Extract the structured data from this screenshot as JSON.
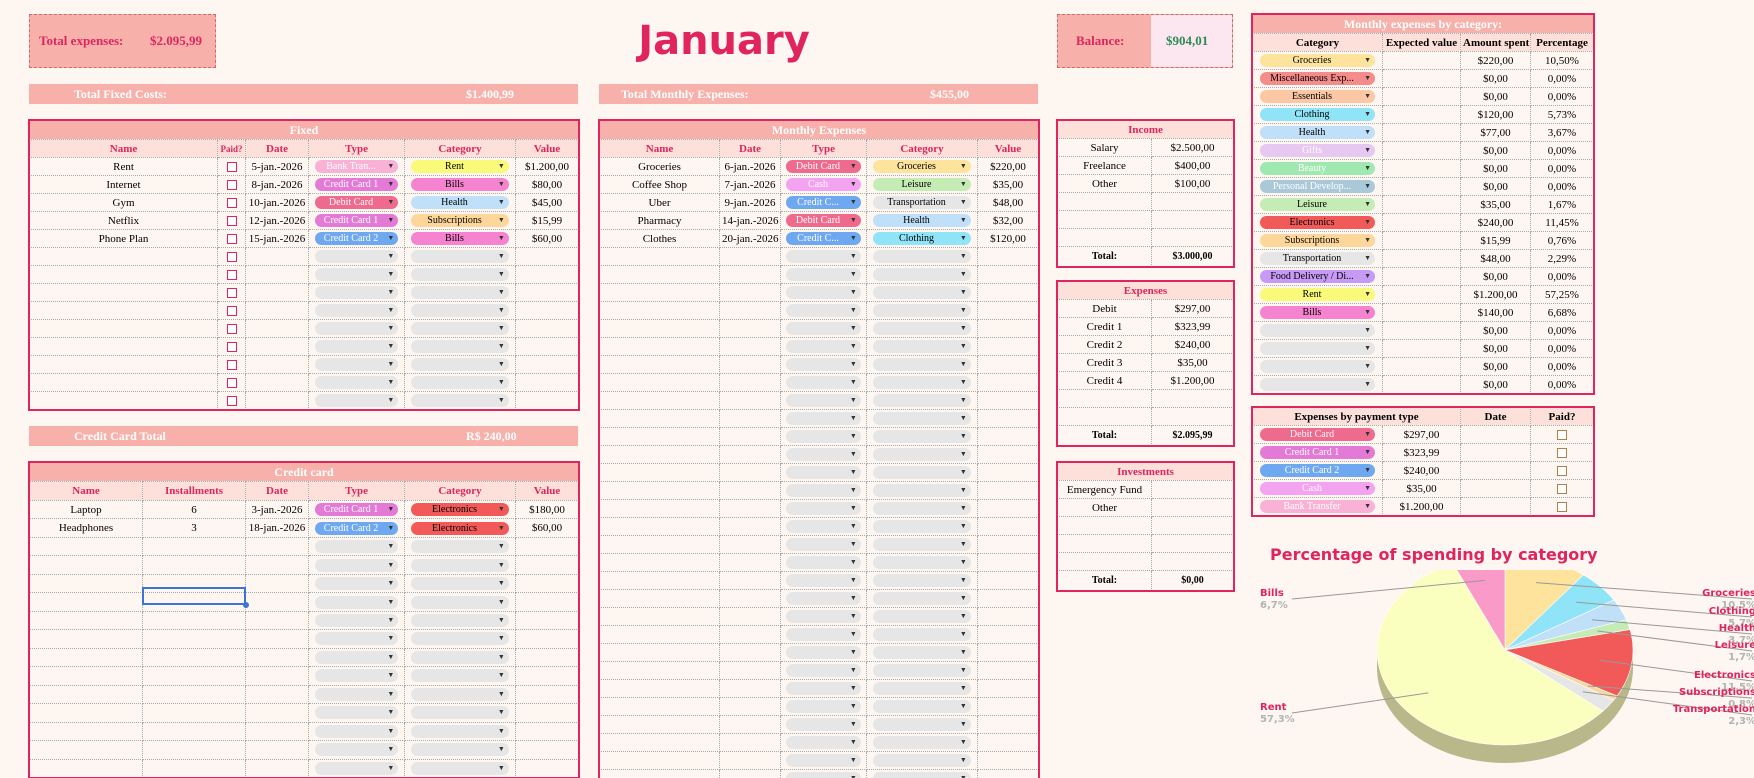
{
  "month": "January",
  "summary": {
    "total_label": "Total expenses:",
    "total_value": "$2.095,99",
    "balance_label": "Balance:",
    "balance_value": "$904,01"
  },
  "bars": {
    "fixed_label": "Total Fixed Costs:",
    "fixed_value": "$1.400,99",
    "monthly_label": "Total Monthly Expenses:",
    "monthly_value": "$455,00",
    "cc_label": "Credit Card Total",
    "cc_value": "R$ 240,00"
  },
  "colors": {
    "accent": "#e0245e",
    "header_bg": "#f7b1aa",
    "subheader_bg": "#fde0da",
    "page_bg": "#fdf6f1",
    "balance_green": "#2e8b57"
  },
  "chip_colors": {
    "Bank Tran...": "#f9b2d6",
    "Bank Transfer": "#f9b2d6",
    "Credit Card 1": "#e27ad6",
    "Credit Card 2": "#6ea8f0",
    "Credit C...": "#6ea8f0",
    "Debit Card": "#ee6b8d",
    "Cash": "#f3a3f0",
    "Rent": "#fafa7a",
    "Bills": "#f683cf",
    "Health": "#bfe0f8",
    "Subscriptions": "#fdd79a",
    "Groceries": "#fde39c",
    "Leisure": "#c6ecb5",
    "Transportation": "#e6e6e6",
    "Clothing": "#8fe4f8",
    "Electronics": "#f25a5a",
    "Miscellaneous Exp...": "#f58c8c",
    "Essentials": "#fbc7a4",
    "Gifts": "#e7c8f1",
    "Beauty": "#9fe8b0",
    "Personal Develop...": "#a9c9d9",
    "Food Delivery / Di...": "#c69af5",
    "": "#e6e6e6"
  },
  "fixed": {
    "title": "Fixed",
    "headers": [
      "Name",
      "Paid?",
      "Date",
      "Type",
      "Category",
      "Value"
    ],
    "rows": [
      {
        "name": "Rent",
        "date": "5-jan.-2026",
        "type": "Bank Tran...",
        "category": "Rent",
        "value": "$1.200,00"
      },
      {
        "name": "Internet",
        "date": "8-jan.-2026",
        "type": "Credit Card 1",
        "category": "Bills",
        "value": "$80,00"
      },
      {
        "name": "Gym",
        "date": "10-jan.-2026",
        "type": "Debit Card",
        "category": "Health",
        "value": "$45,00"
      },
      {
        "name": "Netflix",
        "date": "12-jan.-2026",
        "type": "Credit Card 1",
        "category": "Subscriptions",
        "value": "$15,99"
      },
      {
        "name": "Phone Plan",
        "date": "15-jan.-2026",
        "type": "Credit Card 2",
        "category": "Bills",
        "value": "$60,00"
      }
    ],
    "empty_rows": 9
  },
  "credit_card": {
    "title": "Credit card",
    "headers": [
      "Name",
      "Installments",
      "Date",
      "Type",
      "Category",
      "Value"
    ],
    "rows": [
      {
        "name": "Laptop",
        "installments": "6",
        "date": "3-jan.-2026",
        "type": "Credit Card 1",
        "category": "Electronics",
        "value": "$180,00"
      },
      {
        "name": "Headphones",
        "installments": "3",
        "date": "18-jan.-2026",
        "type": "Credit Card 2",
        "category": "Electronics",
        "value": "$60,00"
      }
    ],
    "empty_rows": 13
  },
  "monthly": {
    "title": "Monthly Expenses",
    "headers": [
      "Name",
      "Date",
      "Type",
      "Category",
      "Value"
    ],
    "rows": [
      {
        "name": "Groceries",
        "date": "6-jan.-2026",
        "type": "Debit Card",
        "category": "Groceries",
        "value": "$220,00"
      },
      {
        "name": "Coffee Shop",
        "date": "7-jan.-2026",
        "type": "Cash",
        "category": "Leisure",
        "value": "$35,00"
      },
      {
        "name": "Uber",
        "date": "9-jan.-2026",
        "type": "Credit C...",
        "category": "Transportation",
        "value": "$48,00"
      },
      {
        "name": "Pharmacy",
        "date": "14-jan.-2026",
        "type": "Debit Card",
        "category": "Health",
        "value": "$32,00"
      },
      {
        "name": "Clothes",
        "date": "20-jan.-2026",
        "type": "Credit C...",
        "category": "Clothing",
        "value": "$120,00"
      }
    ],
    "empty_rows": 30
  },
  "income": {
    "title": "Income",
    "rows": [
      {
        "label": "Salary",
        "value": "$2.500,00"
      },
      {
        "label": "Freelance",
        "value": "$400,00"
      },
      {
        "label": "Other",
        "value": "$100,00"
      }
    ],
    "empty_rows": 3,
    "total_label": "Total:",
    "total_value": "$3.000,00"
  },
  "expenses": {
    "title": "Expenses",
    "rows": [
      {
        "label": "Debit",
        "value": "$297,00"
      },
      {
        "label": "Credit 1",
        "value": "$323,99"
      },
      {
        "label": "Credit 2",
        "value": "$240,00"
      },
      {
        "label": "Credit 3",
        "value": "$35,00"
      },
      {
        "label": "Credit 4",
        "value": "$1.200,00"
      }
    ],
    "empty_rows": 2,
    "total_label": "Total:",
    "total_value": "$2.095,99"
  },
  "investments": {
    "title": "Investments",
    "rows": [
      {
        "label": "Emergency Fund",
        "value": ""
      },
      {
        "label": "Other",
        "value": ""
      }
    ],
    "empty_rows": 3,
    "total_label": "Total:",
    "total_value": "$0,00"
  },
  "by_category": {
    "title": "Monthly expenses by category:",
    "headers": [
      "Category",
      "Expected value",
      "Amount spent",
      "Percentage"
    ],
    "rows": [
      {
        "category": "Groceries",
        "amount": "$220,00",
        "pct": "10,50%"
      },
      {
        "category": "Miscellaneous Exp...",
        "amount": "$0,00",
        "pct": "0,00%"
      },
      {
        "category": "Essentials",
        "amount": "$0,00",
        "pct": "0,00%"
      },
      {
        "category": "Clothing",
        "amount": "$120,00",
        "pct": "5,73%"
      },
      {
        "category": "Health",
        "amount": "$77,00",
        "pct": "3,67%"
      },
      {
        "category": "Gifts",
        "amount": "$0,00",
        "pct": "0,00%"
      },
      {
        "category": "Beauty",
        "amount": "$0,00",
        "pct": "0,00%"
      },
      {
        "category": "Personal Develop...",
        "amount": "$0,00",
        "pct": "0,00%"
      },
      {
        "category": "Leisure",
        "amount": "$35,00",
        "pct": "1,67%"
      },
      {
        "category": "Electronics",
        "amount": "$240,00",
        "pct": "11,45%"
      },
      {
        "category": "Subscriptions",
        "amount": "$15,99",
        "pct": "0,76%"
      },
      {
        "category": "Transportation",
        "amount": "$48,00",
        "pct": "2,29%"
      },
      {
        "category": "Food Delivery / Di...",
        "amount": "$0,00",
        "pct": "0,00%"
      },
      {
        "category": "Rent",
        "amount": "$1.200,00",
        "pct": "57,25%"
      },
      {
        "category": "Bills",
        "amount": "$140,00",
        "pct": "6,68%"
      },
      {
        "category": "",
        "amount": "$0,00",
        "pct": "0,00%"
      },
      {
        "category": "",
        "amount": "$0,00",
        "pct": "0,00%"
      },
      {
        "category": "",
        "amount": "$0,00",
        "pct": "0,00%"
      },
      {
        "category": "",
        "amount": "$0,00",
        "pct": "0,00%"
      }
    ]
  },
  "by_payment": {
    "title": "Expenses by payment type",
    "headers": [
      "",
      "",
      "Date",
      "Paid?"
    ],
    "rows": [
      {
        "type": "Debit Card",
        "value": "$297,00"
      },
      {
        "type": "Credit Card 1",
        "value": "$323,99"
      },
      {
        "type": "Credit Card 2",
        "value": "$240,00"
      },
      {
        "type": "Cash",
        "value": "$35,00"
      },
      {
        "type": "Bank Transfer",
        "value": "$1.200,00"
      }
    ]
  },
  "chart_data": {
    "type": "pie",
    "title": "Percentage of spending by category",
    "categories": [
      "Groceries",
      "Clothing",
      "Health",
      "Leisure",
      "Electronics",
      "Subscriptions",
      "Transportation",
      "Rent",
      "Bills"
    ],
    "values": [
      10.5,
      5.7,
      3.7,
      1.7,
      11.5,
      0.8,
      2.3,
      57.3,
      6.7
    ],
    "labels": [
      "10,5%",
      "5,7%",
      "3,7%",
      "1,7%",
      "11,5%",
      "0,8%",
      "2,3%",
      "57,3%",
      "6,7%"
    ],
    "colors": [
      "#fde39c",
      "#8fe4f8",
      "#bfe0f8",
      "#c6ecb5",
      "#f25a5a",
      "#fdd79a",
      "#e6e6e6",
      "#fafebf",
      "#f99ac9"
    ],
    "legend": "none"
  }
}
